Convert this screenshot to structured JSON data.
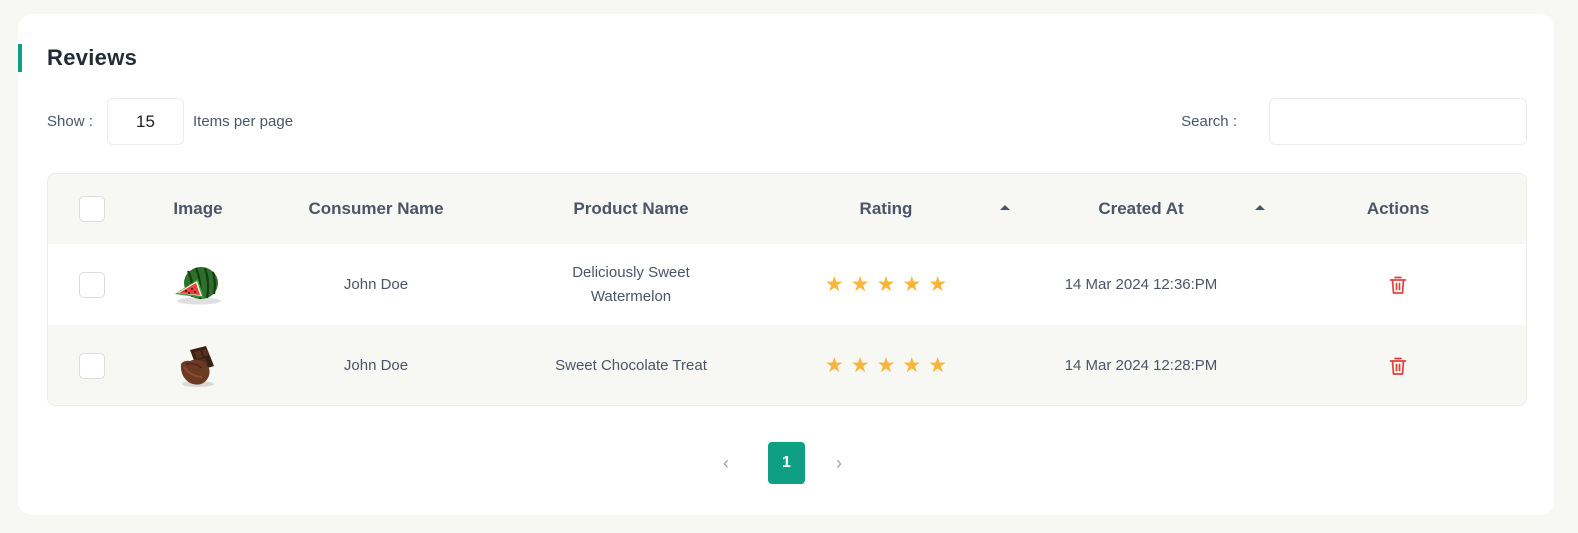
{
  "page_title": "Reviews",
  "controls": {
    "show_label": "Show :",
    "per_page_value": "15",
    "per_page_label": "Items per page",
    "search_label": "Search :",
    "search_value": ""
  },
  "table": {
    "headers": {
      "image": "Image",
      "consumer": "Consumer Name",
      "product": "Product Name",
      "rating": "Rating",
      "created": "Created At",
      "actions": "Actions"
    },
    "rows": [
      {
        "image_icon": "watermelon-icon",
        "consumer": "John Doe",
        "product_line1": "Deliciously Sweet",
        "product_line2": "Watermelon",
        "rating": 5,
        "created": "14 Mar 2024 12:36:PM"
      },
      {
        "image_icon": "chocolate-icon",
        "consumer": "John Doe",
        "product_line1": "Sweet Chocolate Treat",
        "product_line2": "",
        "rating": 5,
        "created": "14 Mar 2024 12:28:PM"
      }
    ]
  },
  "pagination": {
    "prev": "‹",
    "current": "1",
    "next": "›"
  },
  "colors": {
    "accent": "#0e9f85",
    "star": "#f7b539",
    "delete": "#e53e3e",
    "background": "#f7f7f3"
  }
}
